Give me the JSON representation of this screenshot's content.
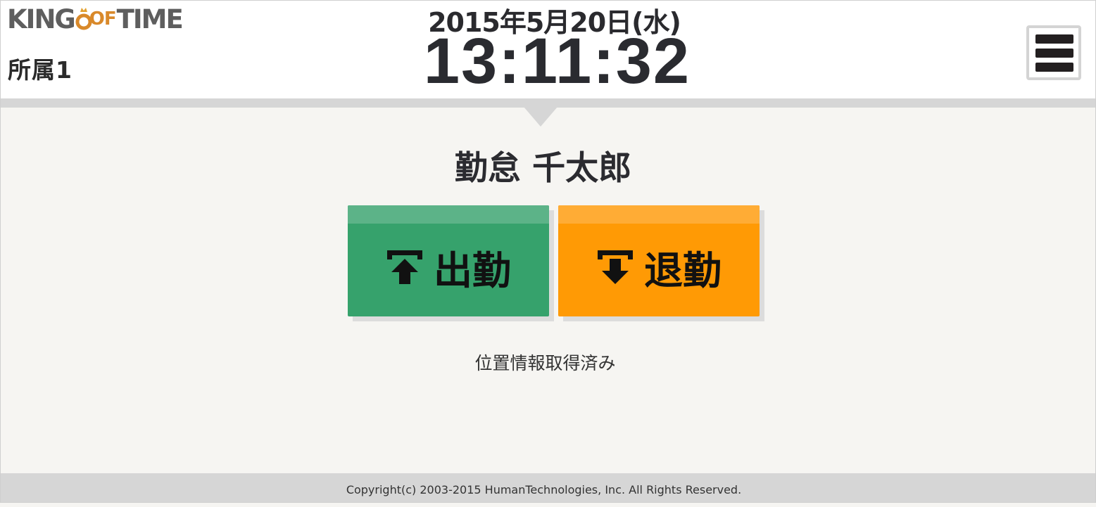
{
  "app": {
    "logo_text_left": "KING",
    "logo_text_of": "OF",
    "logo_text_right": "TIME",
    "affiliation": "所属1"
  },
  "header": {
    "date": "2015年5月20日(水)",
    "time": "13:11:32",
    "menu_icon": "hamburger-icon"
  },
  "employee": {
    "name": "勤怠 千太郎"
  },
  "buttons": {
    "clock_in": {
      "label": "出勤",
      "icon": "arrow-up-to-bar-icon",
      "color": "#36a26c"
    },
    "clock_out": {
      "label": "退勤",
      "icon": "arrow-down-to-bar-icon",
      "color": "#ff9a05"
    }
  },
  "status": {
    "location": "位置情報取得済み"
  },
  "footer": {
    "copyright": "Copyright(c) 2003-2015 HumanTechnologies, Inc. All Rights Reserved."
  }
}
